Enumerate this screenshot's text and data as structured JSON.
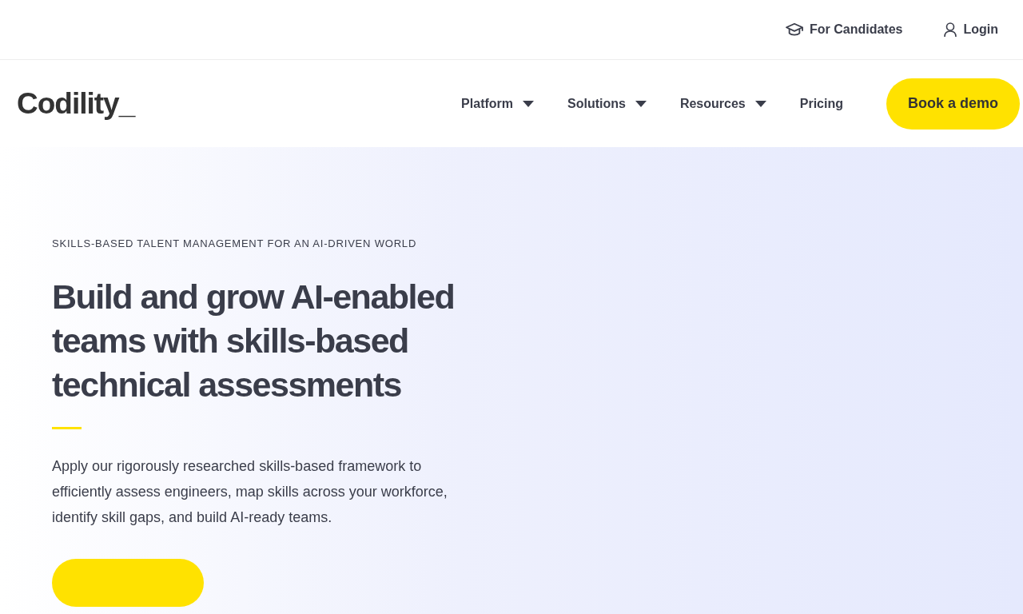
{
  "top_links": [
    {
      "kind": "candidates",
      "label": "For Candidates"
    },
    {
      "kind": "login",
      "label": "Login"
    }
  ],
  "logo": "Codility_",
  "nav": [
    {
      "label": "Platform",
      "dropdown": true
    },
    {
      "label": "Solutions",
      "dropdown": true
    },
    {
      "label": "Resources",
      "dropdown": true
    },
    {
      "label": "Pricing",
      "dropdown": false
    }
  ],
  "nav_button": "Book a demo",
  "hero": {
    "eyebrow": "SKILLS-BASED TALENT MANAGEMENT FOR AN AI-DRIVEN WORLD",
    "heading": "Build and grow AI-enabled teams with skills-based technical assessments",
    "body": "Apply our rigorously researched skills-based framework to efficiently assess engineers, map skills across your workforce, identify skill gaps, and build AI-ready teams."
  }
}
